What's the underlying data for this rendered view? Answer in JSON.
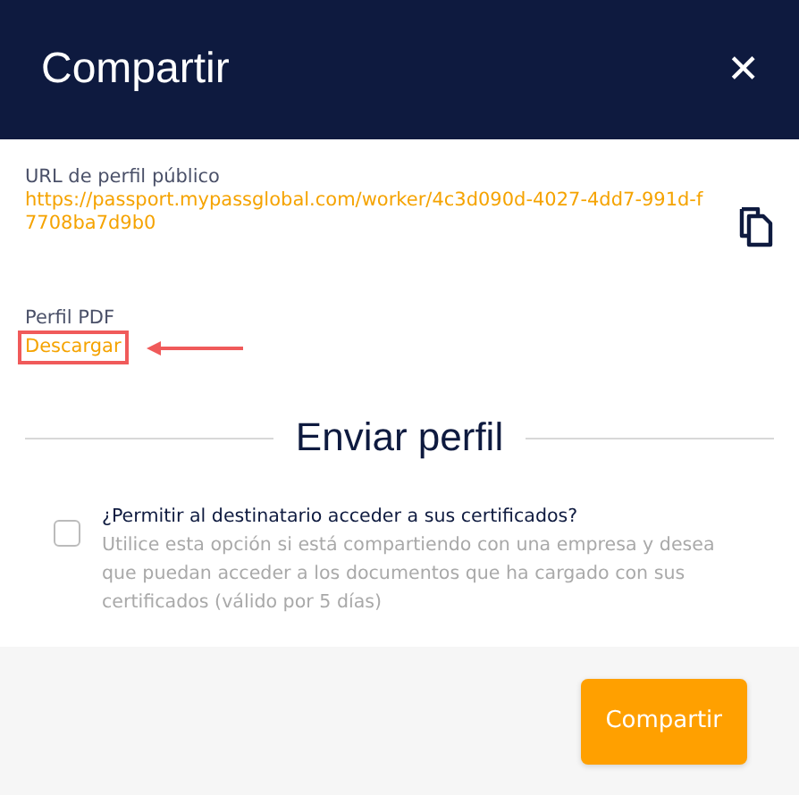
{
  "window": {
    "title": "Compartir",
    "close": "✕"
  },
  "public_url": {
    "label": "URL de perfil público",
    "value": "https://passport.mypassglobal.com/worker/4c3d090d-4027-4dd7-991d-f7708ba7d9b0"
  },
  "pdf": {
    "label": "Perfil PDF",
    "link": "Descargar",
    "highlighted": true
  },
  "send": {
    "heading": "Enviar perfil",
    "option": {
      "label": "¿Permitir al destinatario acceder a sus certificados?",
      "description": "Utilice esta opción si está compartiendo con una empresa y desea que puedan acceder a los documentos que ha cargado con sus certificados (válido por 5 días)",
      "checked": false
    }
  },
  "buttons": [
    "Compartir"
  ]
}
